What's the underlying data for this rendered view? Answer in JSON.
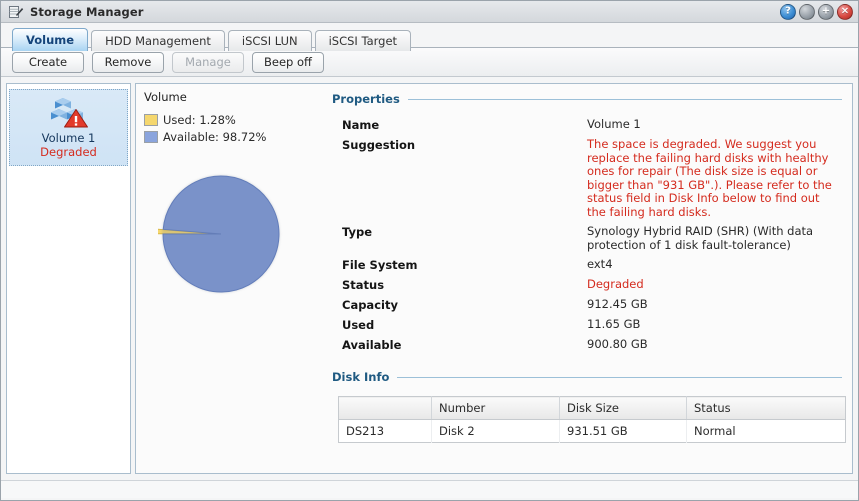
{
  "window": {
    "title": "Storage Manager",
    "icon": "storage-manager-icon",
    "buttons": {
      "help": "?",
      "minimize": "·",
      "maximize": "+",
      "close": "×"
    }
  },
  "tabs": [
    {
      "label": "Volume",
      "active": true
    },
    {
      "label": "HDD Management",
      "active": false
    },
    {
      "label": "iSCSI LUN",
      "active": false
    },
    {
      "label": "iSCSI Target",
      "active": false
    }
  ],
  "toolbar": {
    "create_label": "Create",
    "remove_label": "Remove",
    "manage_label": "Manage",
    "beep_label": "Beep off"
  },
  "sidebar": {
    "items": [
      {
        "name": "Volume 1",
        "status": "Degraded",
        "icon": "volume-warning-icon",
        "selected": true
      }
    ]
  },
  "chart_panel": {
    "title": "Volume"
  },
  "chart_data": {
    "type": "pie",
    "title": "Volume",
    "labels": [
      "Used",
      "Available"
    ],
    "values": [
      1.28,
      98.72
    ],
    "legend": [
      "Used: 1.28%",
      "Available: 98.72%"
    ],
    "legend_position": "top-left",
    "colors": [
      "#f5d76e",
      "#7b96d9"
    ],
    "units": "%"
  },
  "properties": {
    "section_title": "Properties",
    "rows": [
      {
        "label": "Name",
        "value": "Volume 1",
        "style": "normal"
      },
      {
        "label": "Suggestion",
        "value": "The space is degraded. We suggest you replace the failing hard disks with healthy ones for repair (The disk size is equal or bigger than \"931 GB\".). Please refer to the status field in Disk Info below to find out the failing hard disks.",
        "style": "warn"
      },
      {
        "label": "Type",
        "value": "Synology Hybrid RAID (SHR) (With data protection of 1 disk fault-tolerance)",
        "style": "normal"
      },
      {
        "label": "File System",
        "value": "ext4",
        "style": "normal"
      },
      {
        "label": "Status",
        "value": "Degraded",
        "style": "bad"
      },
      {
        "label": "Capacity",
        "value": "912.45 GB",
        "style": "normal"
      },
      {
        "label": "Used",
        "value": "11.65 GB",
        "style": "normal"
      },
      {
        "label": "Available",
        "value": "900.80 GB",
        "style": "normal"
      }
    ]
  },
  "disk_info": {
    "section_title": "Disk Info",
    "columns": [
      "",
      "Number",
      "Disk Size",
      "Status"
    ],
    "rows": [
      {
        "model": "DS213",
        "number": "Disk 2",
        "size": "931.51 GB",
        "status": "Normal"
      }
    ]
  },
  "colors": {
    "accent": "#1f5a82",
    "warning": "#d42b1e",
    "ok": "#2f7a33",
    "pie_used": "#f5d76e",
    "pie_available": "#7b96d9"
  }
}
